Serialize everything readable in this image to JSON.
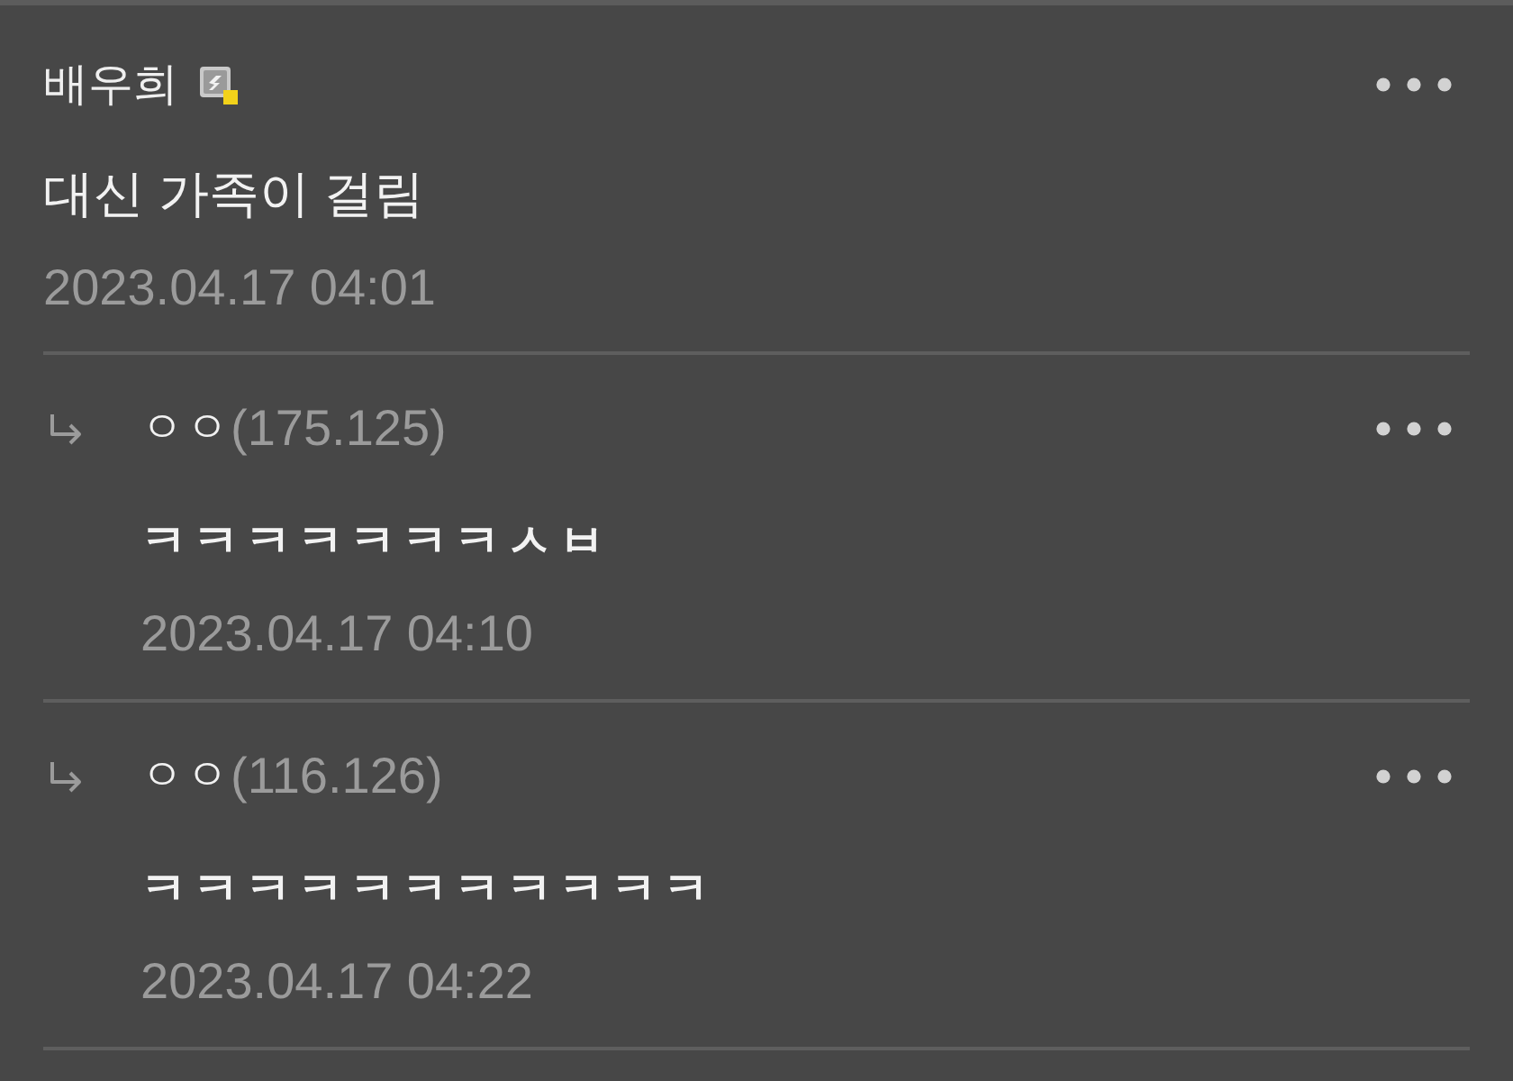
{
  "post": {
    "author": "배우희",
    "title": "대신 가족이 걸림",
    "date": "2023.04.17 04:01"
  },
  "replies": [
    {
      "nickname": "ㅇㅇ",
      "ip": "(175.125)",
      "text": "ㅋㅋㅋㅋㅋㅋㅋㅅㅂ",
      "date": "2023.04.17 04:10"
    },
    {
      "nickname": "ㅇㅇ",
      "ip": "(116.126)",
      "text": "ㅋㅋㅋㅋㅋㅋㅋㅋㅋㅋㅋ",
      "date": "2023.04.17 04:22"
    }
  ]
}
